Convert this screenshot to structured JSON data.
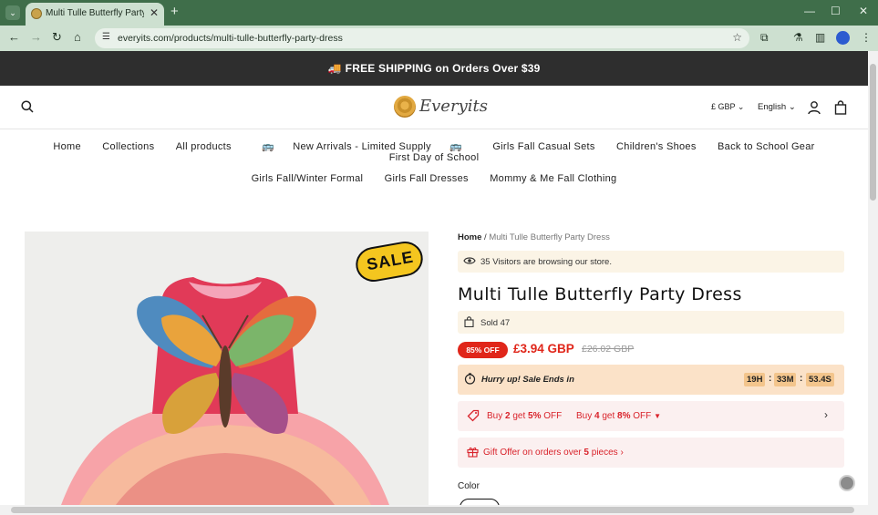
{
  "browser": {
    "tab_title": "Multi Tulle Butterfly Party Dress",
    "url": "everyits.com/products/multi-tulle-butterfly-party-dress"
  },
  "store": {
    "announcement": "FREE SHIPPING on Orders Over $39",
    "logo_text": "Everyits",
    "currency": "£ GBP",
    "language": "English"
  },
  "menu": {
    "row1": [
      "Home",
      "Collections",
      "All products",
      "New Arrivals - Limited Supply",
      "Girls Fall Casual Sets",
      "Children's Shoes",
      "Back to School Gear",
      "First Day of School"
    ],
    "row2": [
      "Girls Fall/Winter Formal",
      "Girls Fall Dresses",
      "Mommy & Me Fall Clothing"
    ]
  },
  "product": {
    "sale_badge": "SALE",
    "breadcrumb_home": "Home",
    "breadcrumb_sep": "/",
    "breadcrumb_current": "Multi Tulle Butterfly Party Dress",
    "visitors": "35 Visitors are browsing our store.",
    "title": "Multi Tulle Butterfly Party Dress",
    "sold": "Sold 47",
    "discount_badge": "85% OFF",
    "price": "£3.94 GBP",
    "compare_price": "£26.02 GBP",
    "hurry_text": "Hurry up! Sale Ends in",
    "timer": {
      "hours": "19H",
      "minutes": "33M",
      "seconds": "53.4S",
      "sep": ":"
    },
    "offer_1": {
      "pre": "Buy ",
      "qty": "2",
      "mid": " get ",
      "pct": "5%",
      "post": " OFF"
    },
    "offer_2": {
      "pre": "Buy ",
      "qty": "4",
      "mid": " get ",
      "pct": "8%",
      "post": " OFF"
    },
    "gift_offer": {
      "pre": "Gift Offer on orders over ",
      "qty": "5",
      "post": " pieces"
    },
    "color_label": "Color"
  },
  "colors": {
    "accent_red": "#e0261a",
    "announcement_bg": "#2e2e2e",
    "chrome_green": "#3f6e4a"
  }
}
